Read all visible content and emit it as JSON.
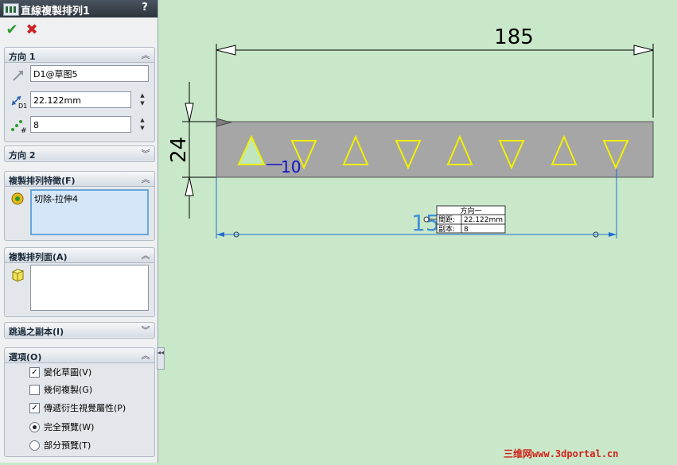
{
  "panel": {
    "title": "直線複製排列1",
    "help": "?",
    "ok_icon": "✔",
    "cancel_icon": "✖",
    "direction1": {
      "header": "方向 1",
      "chevron": "︽",
      "direction_value": "D1@草图5",
      "spacing_value": "22.122mm",
      "count_value": "8",
      "spin_up": "▲",
      "spin_down": "▼"
    },
    "direction2": {
      "header": "方向 2",
      "chevron": "︾"
    },
    "features": {
      "header": "複製排列特徵(F)",
      "chevron": "︽",
      "items": [
        "切除-拉伸4"
      ]
    },
    "faces": {
      "header": "複製排列面(A)",
      "chevron": "︽"
    },
    "skip": {
      "header": "跳過之副本(I)",
      "chevron": "︾"
    },
    "options": {
      "header": "選項(O)",
      "chevron": "︽",
      "vary_sketch": "變化草圖(V)",
      "geometry_pattern": "幾何複製(G)",
      "propagate_visual": "傳遞衍生視覺屬性(P)",
      "full_preview": "完全預覽(W)",
      "partial_preview": "部分預覽(T)",
      "check_mark": "✓"
    },
    "collapse_arrows": "◂◂"
  },
  "canvas": {
    "dim_width": "185",
    "dim_height": "24",
    "dim_offset": "10",
    "dim_pitch": "15",
    "callout": {
      "title": "方向一",
      "spacing_label": "間距:",
      "spacing_value": "22.122mm",
      "count_label": "副本:",
      "count_value": "8"
    }
  },
  "watermark": {
    "part1": "三维网",
    "part2": "www.3dportal.cn"
  },
  "colors": {
    "background": "#c9e8c9",
    "plate": "#a6a6a6",
    "triangle": "#f2f200",
    "dimension": "#1f6fd0",
    "sketch_dim": "#1212c8"
  }
}
